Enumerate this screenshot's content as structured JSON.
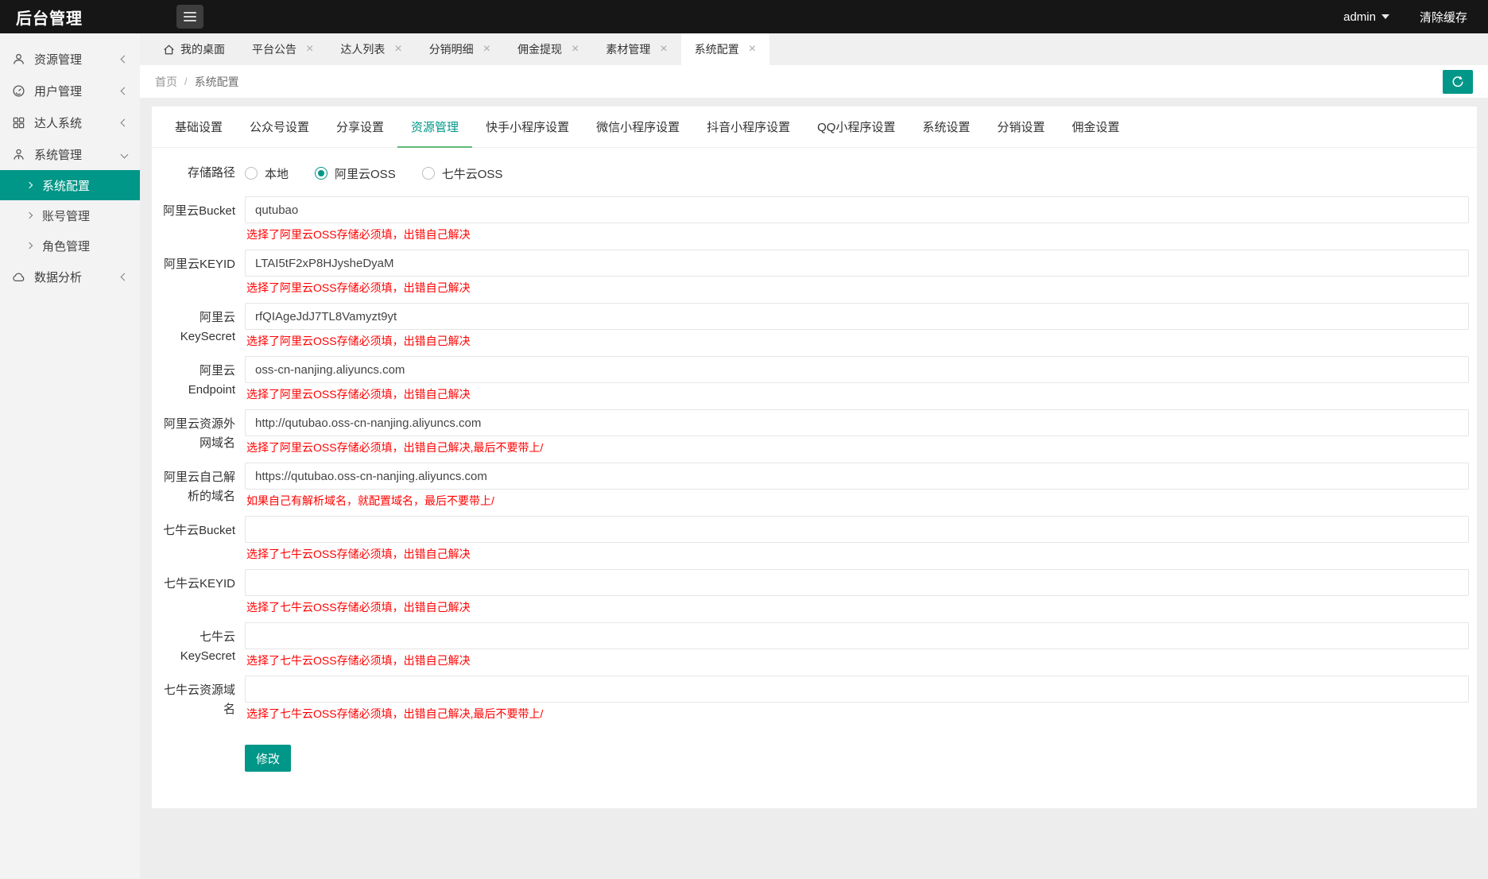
{
  "topbar": {
    "title": "后台管理",
    "user": "admin",
    "clear_cache": "清除缓存"
  },
  "sidebar": {
    "items": [
      {
        "label": "资源管理",
        "icon": "user-icon",
        "chevron": "left"
      },
      {
        "label": "用户管理",
        "icon": "circle-gauge-icon",
        "chevron": "left"
      },
      {
        "label": "达人系统",
        "icon": "grid-icon",
        "chevron": "left"
      },
      {
        "label": "系统管理",
        "icon": "member-icon",
        "chevron": "down",
        "children": [
          {
            "label": "系统配置",
            "active": true
          },
          {
            "label": "账号管理",
            "active": false
          },
          {
            "label": "角色管理",
            "active": false
          }
        ]
      },
      {
        "label": "数据分析",
        "icon": "cloud-icon",
        "chevron": "left"
      }
    ]
  },
  "tabbar": {
    "home_label": "我的桌面",
    "close_glyph": "×",
    "tabs": [
      {
        "label": "平台公告",
        "active": false
      },
      {
        "label": "达人列表",
        "active": false
      },
      {
        "label": "分销明细",
        "active": false
      },
      {
        "label": "佣金提现",
        "active": false
      },
      {
        "label": "素材管理",
        "active": false
      },
      {
        "label": "系统配置",
        "active": true
      }
    ]
  },
  "breadcrumb": {
    "home": "首页",
    "separator": "/",
    "current": "系统配置"
  },
  "panel": {
    "tabs": [
      "基础设置",
      "公众号设置",
      "分享设置",
      "资源管理",
      "快手小程序设置",
      "微信小程序设置",
      "抖音小程序设置",
      "QQ小程序设置",
      "系统设置",
      "分销设置",
      "佣金设置"
    ],
    "active_tab": "资源管理"
  },
  "form": {
    "storage": {
      "label": "存储路径",
      "options": [
        {
          "label": "本地",
          "checked": false
        },
        {
          "label": "阿里云OSS",
          "checked": true
        },
        {
          "label": "七牛云OSS",
          "checked": false
        }
      ]
    },
    "fields": [
      {
        "name": "aliyun-bucket",
        "label": "阿里云Bucket",
        "value": "qutubao",
        "hint": "选择了阿里云OSS存储必须填，出错自己解决"
      },
      {
        "name": "aliyun-keyid",
        "label": "阿里云KEYID",
        "value": "LTAI5tF2xP8HJysheDyaM",
        "hint": "选择了阿里云OSS存储必须填，出错自己解决"
      },
      {
        "name": "aliyun-keysecret",
        "label": "阿里云KeySecret",
        "value": "rfQIAgeJdJ7TL8Vamyzt9yt",
        "hint": "选择了阿里云OSS存储必须填，出错自己解决"
      },
      {
        "name": "aliyun-endpoint",
        "label": "阿里云Endpoint",
        "value": "oss-cn-nanjing.aliyuncs.com",
        "hint": "选择了阿里云OSS存储必须填，出错自己解决"
      },
      {
        "name": "aliyun-public-domain",
        "label": "阿里云资源外网域名",
        "value": "http://qutubao.oss-cn-nanjing.aliyuncs.com",
        "hint": "选择了阿里云OSS存储必须填，出错自己解决,最后不要带上/"
      },
      {
        "name": "aliyun-custom-domain",
        "label": "阿里云自己解析的域名",
        "value": "https://qutubao.oss-cn-nanjing.aliyuncs.com",
        "hint": "如果自己有解析域名，就配置域名，最后不要带上/"
      },
      {
        "name": "qiniu-bucket",
        "label": "七牛云Bucket",
        "value": "",
        "hint": "选择了七牛云OSS存储必须填，出错自己解决"
      },
      {
        "name": "qiniu-keyid",
        "label": "七牛云KEYID",
        "value": "",
        "hint": "选择了七牛云OSS存储必须填，出错自己解决"
      },
      {
        "name": "qiniu-keysecret",
        "label": "七牛云KeySecret",
        "value": "",
        "hint": "选择了七牛云OSS存储必须填，出错自己解决"
      },
      {
        "name": "qiniu-domain",
        "label": "七牛云资源域名",
        "value": "",
        "hint": "选择了七牛云OSS存储必须填，出错自己解决,最后不要带上/"
      }
    ],
    "submit_label": "修改"
  },
  "colors": {
    "accent": "#009688",
    "tab_underline": "#5FB878",
    "hint_red": "#FF0000",
    "topbar_bg": "#161616"
  }
}
